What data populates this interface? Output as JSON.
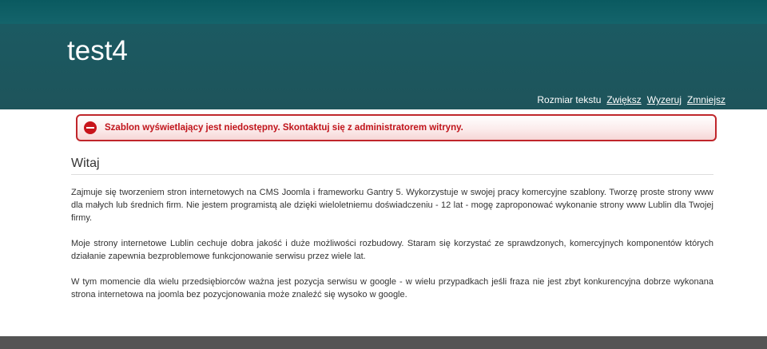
{
  "header": {
    "site_title": "test4",
    "textsize": {
      "label": "Rozmiar tekstu",
      "increase": "Zwiększ",
      "reset": "Wyzeruj",
      "decrease": "Zmniejsz"
    }
  },
  "alert": {
    "icon": "stop-icon",
    "message": "Szablon wyświetlający jest niedostępny. Skontaktuj się z administratorem witryny.",
    "color": "#c0141b"
  },
  "article": {
    "title": "Witaj",
    "paragraphs": [
      "Zajmuje się tworzeniem stron internetowych na CMS Joomla i frameworku Gantry 5. Wykorzystuje w swojej pracy komercyjne szablony. Tworzę proste strony www dla małych lub średnich firm. Nie jestem programistą ale dzięki wieloletniemu doświadczeniu - 12 lat - mogę zaproponować wykonanie strony www Lublin dla Twojej firmy.",
      "Moje strony internetowe Lublin cechuje dobra jakość i duże możliwości rozbudowy. Staram się korzystać ze sprawdzonych, komercyjnych komponentów których działanie zapewnia bezproblemowe funkcjonowanie serwisu przez wiele lat.",
      "W tym momencie dla wielu przedsiębiorców ważna jest pozycja serwisu w google - w wielu przypadkach jeśli fraza nie jest zbyt konkurencyjna dobrze wykonana strona internetowa na joomla bez pozycjonowania może znaleźć się wysoko w google."
    ]
  },
  "colors": {
    "header_bg": "#1e545b",
    "footer_bg": "#545454",
    "alert_border": "#c0262b"
  }
}
